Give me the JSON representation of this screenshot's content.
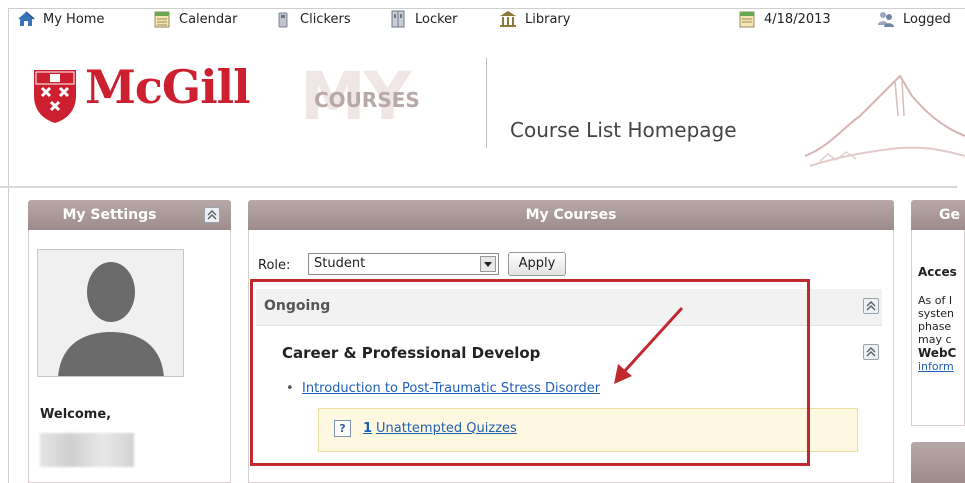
{
  "topnav": {
    "items": [
      {
        "label": "My Home",
        "icon": "home-icon"
      },
      {
        "label": "Calendar",
        "icon": "calendar-icon"
      },
      {
        "label": "Clickers",
        "icon": "clicker-icon"
      },
      {
        "label": "Locker",
        "icon": "locker-icon"
      },
      {
        "label": "Library",
        "icon": "library-icon"
      }
    ],
    "date": "4/18/2013",
    "logged": "Logged"
  },
  "header": {
    "brand": "McGill",
    "app": "COURSES",
    "app_bg": "MY",
    "page_title": "Course List Homepage"
  },
  "settings": {
    "title": "My Settings",
    "welcome": "Welcome,"
  },
  "courses": {
    "title": "My Courses",
    "role_label": "Role:",
    "role_value": "Student",
    "apply_label": "Apply",
    "section_label": "Ongoing",
    "group_label": "Career & Professional Develop",
    "course_link": "Introduction to Post-Traumatic Stress Disorder",
    "quiz_count": "1",
    "quiz_label": "Unattempted Quizzes"
  },
  "right_panel": {
    "title_fragment": "Ge",
    "heading_fragment": "Acces",
    "lines": [
      "As of I",
      "systen",
      "phase",
      "may c"
    ],
    "bold_fragment": "WebC",
    "link_fragment": "inform"
  },
  "colors": {
    "brand_red": "#cc1f2f",
    "panel_header": "#a89696",
    "link": "#1f5fb8",
    "highlight": "#c0292f"
  }
}
